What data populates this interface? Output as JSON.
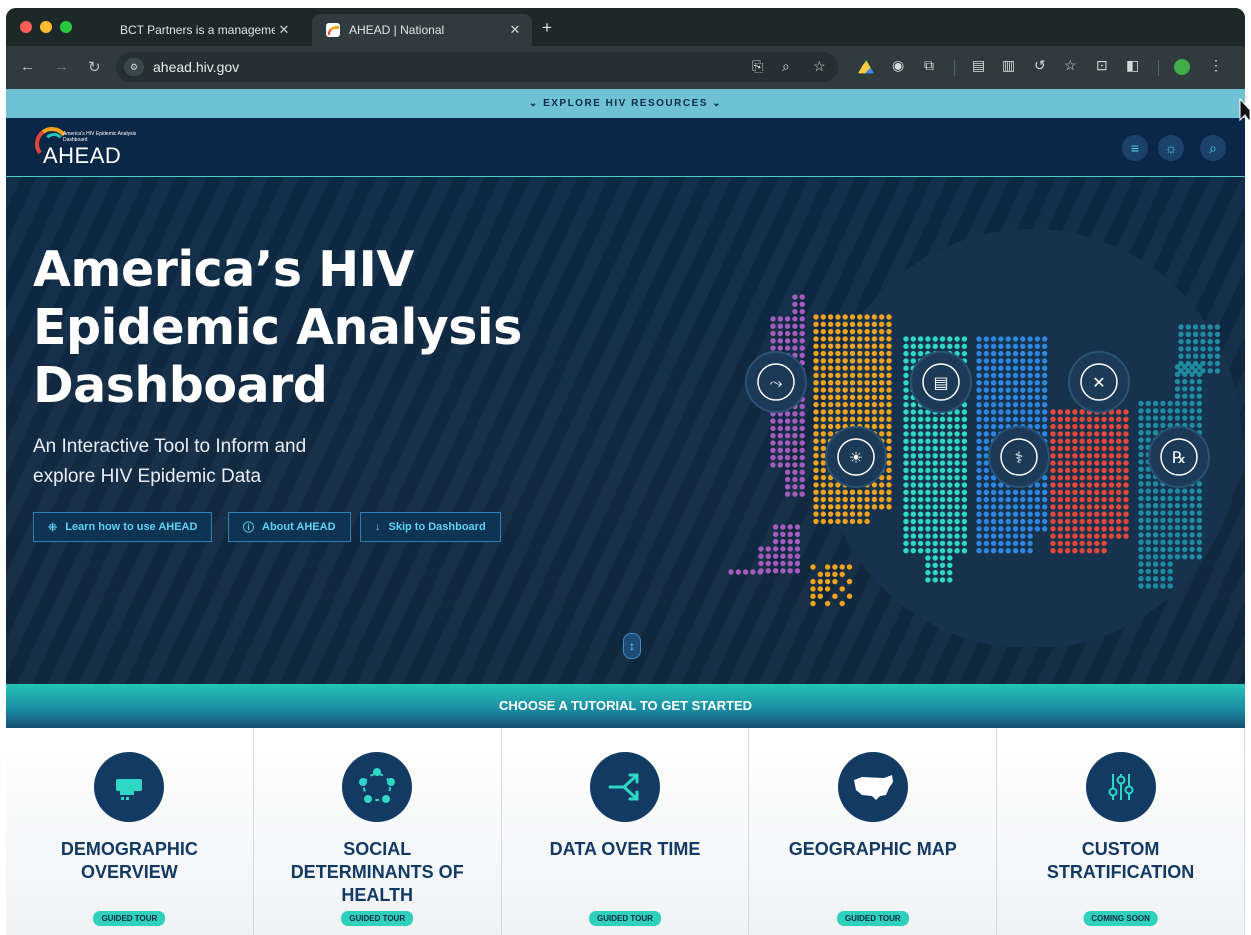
{
  "browser": {
    "tabs": [
      {
        "title": "BCT Partners is a manageme",
        "close": "✕",
        "active": false
      },
      {
        "title": "AHEAD | National",
        "close": "✕",
        "active": true
      }
    ],
    "new_tab": "+",
    "url": "ahead.hiv.gov"
  },
  "banner": {
    "label": "⌄ EXPLORE HIV RESOURCES ⌄"
  },
  "logo": {
    "subtitle": "America's HIV Epidemic Analysis Dashboard",
    "name": "AHEAD"
  },
  "hero": {
    "title": "America’s HIV Epidemic Analysis Dashboard",
    "subtitle": "An Interactive Tool to Inform and explore HIV Epidemic Data",
    "buttons": [
      {
        "label": "Learn how to use AHEAD",
        "icon": "sparkle-icon",
        "glyph": "⁜"
      },
      {
        "label": "About AHEAD",
        "icon": "info-icon",
        "glyph": "ⓘ"
      },
      {
        "label": "Skip to Dashboard",
        "icon": "arrow-down-icon",
        "glyph": "↓"
      }
    ],
    "map_icons": [
      "trend-line-icon",
      "lightbulb-icon",
      "clipboard-icon",
      "caduceus-icon",
      "arrows-in-icon",
      "prescription-icon"
    ]
  },
  "tutorials": {
    "heading": "CHOOSE A TUTORIAL TO GET STARTED",
    "cards": [
      {
        "title": "DEMOGRAPHIC\nOVERVIEW",
        "badge": "GUIDED TOUR",
        "icon": "us-dot-map-icon"
      },
      {
        "title": "SOCIAL\nDETERMINANTS OF\nHEALTH",
        "badge": "GUIDED TOUR",
        "icon": "people-circle-icon"
      },
      {
        "title": "DATA OVER TIME",
        "badge": "GUIDED TOUR",
        "icon": "diverging-arrows-icon"
      },
      {
        "title": "GEOGRAPHIC MAP",
        "badge": "GUIDED TOUR",
        "icon": "us-map-icon"
      },
      {
        "title": "CUSTOM\nSTRATIFICATION",
        "badge": "COMING SOON",
        "icon": "sliders-icon"
      }
    ]
  },
  "colors": {
    "nav": "#0b2748",
    "accent": "#2fd1bd",
    "banner": "#6fc2d4",
    "map_purple": "#a55bbf",
    "map_orange": "#f2a31c",
    "map_teal": "#2fd8c4",
    "map_blue": "#2f86e0",
    "map_red": "#e8473a",
    "map_darkteal": "#1f8ba0"
  }
}
